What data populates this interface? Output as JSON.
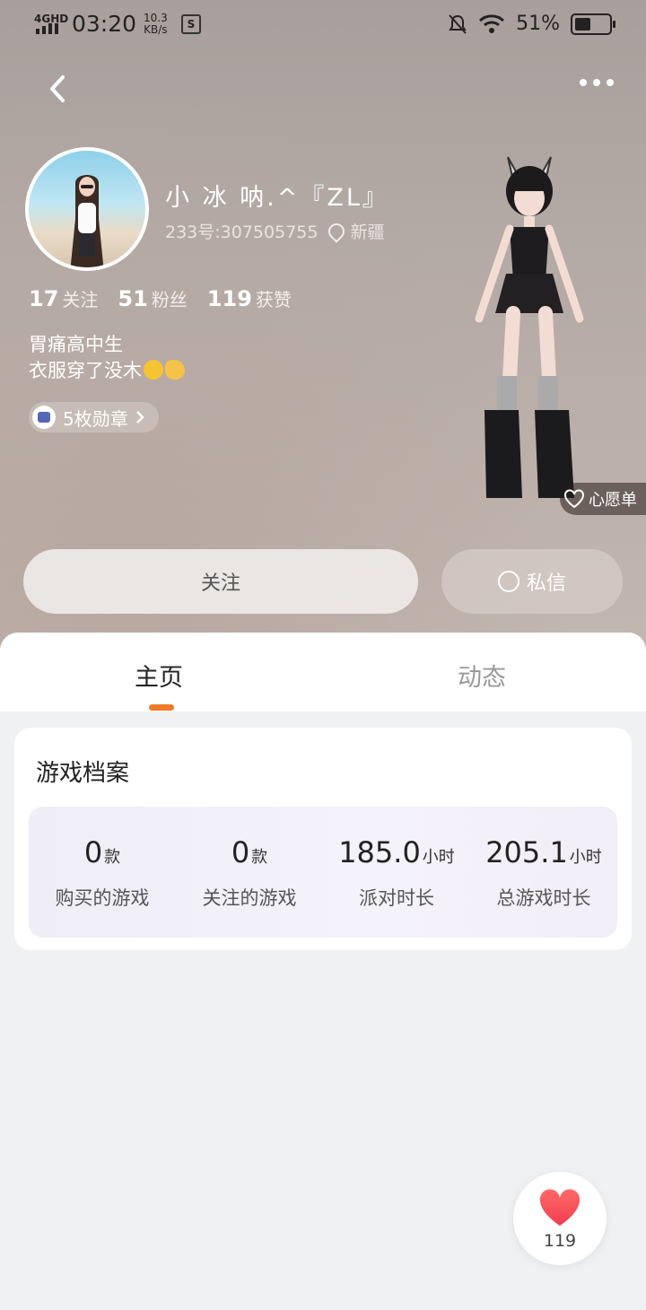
{
  "status_bar": {
    "network": "4GHD",
    "time": "03:20",
    "speed_value": "10.3",
    "speed_unit": "KB/s",
    "battery": "51%",
    "battery_level": 0.51
  },
  "profile": {
    "nickname": "小 冰 呐.^『ZL』",
    "uid": "233号:307505755",
    "location": "新疆",
    "stats": [
      {
        "count": "17",
        "label": "关注"
      },
      {
        "count": "51",
        "label": "粉丝"
      },
      {
        "count": "119",
        "label": "获赞"
      }
    ],
    "bio_line1": "胃痛高中生",
    "bio_line2": "衣服穿了没木",
    "badges_label": "5枚勋章",
    "wishlist_label": "心愿单"
  },
  "actions": {
    "follow_label": "关注",
    "message_label": "私信"
  },
  "tabs": [
    {
      "label": "主页",
      "active": true
    },
    {
      "label": "动态",
      "active": false
    }
  ],
  "game_profile": {
    "title": "游戏档案",
    "items": [
      {
        "value": "0",
        "unit": "款",
        "label": "购买的游戏"
      },
      {
        "value": "0",
        "unit": "款",
        "label": "关注的游戏"
      },
      {
        "value": "185.0",
        "unit": "小时",
        "label": "派对时长"
      },
      {
        "value": "205.1",
        "unit": "小时",
        "label": "总游戏时长"
      }
    ]
  },
  "like_fab": {
    "count": "119"
  },
  "colors": {
    "accent": "#f07a2a",
    "heart": "#f23d4f"
  },
  "icons": [
    "back-icon",
    "more-icon",
    "location-icon",
    "badge-icon",
    "heart-outline-icon",
    "chat-icon",
    "heart-icon"
  ]
}
